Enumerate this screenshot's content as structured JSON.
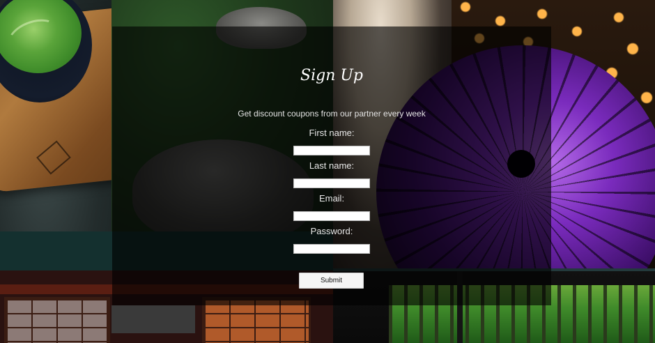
{
  "form": {
    "title": "Sign Up",
    "subtitle": "Get discount coupons from our partner every week",
    "fields": [
      {
        "label": "First name:",
        "value": "",
        "placeholder": "",
        "type": "text"
      },
      {
        "label": "Last name:",
        "value": "",
        "placeholder": "",
        "type": "text"
      },
      {
        "label": "Email:",
        "value": "",
        "placeholder": "",
        "type": "email"
      },
      {
        "label": "Password:",
        "value": "",
        "placeholder": "",
        "type": "password"
      }
    ],
    "submit_label": "Submit"
  },
  "colors": {
    "overlay": "#000000",
    "text": "#ffffff",
    "input_bg": "#ffffff",
    "button_bg": "#f5f5f5"
  },
  "background_photos": [
    "matcha-tea-bowl",
    "zen-garden-rocks",
    "paper-parasol",
    "bamboo-lanterns",
    "purple-parasol",
    "shoji-screen-room",
    "forest-view"
  ]
}
